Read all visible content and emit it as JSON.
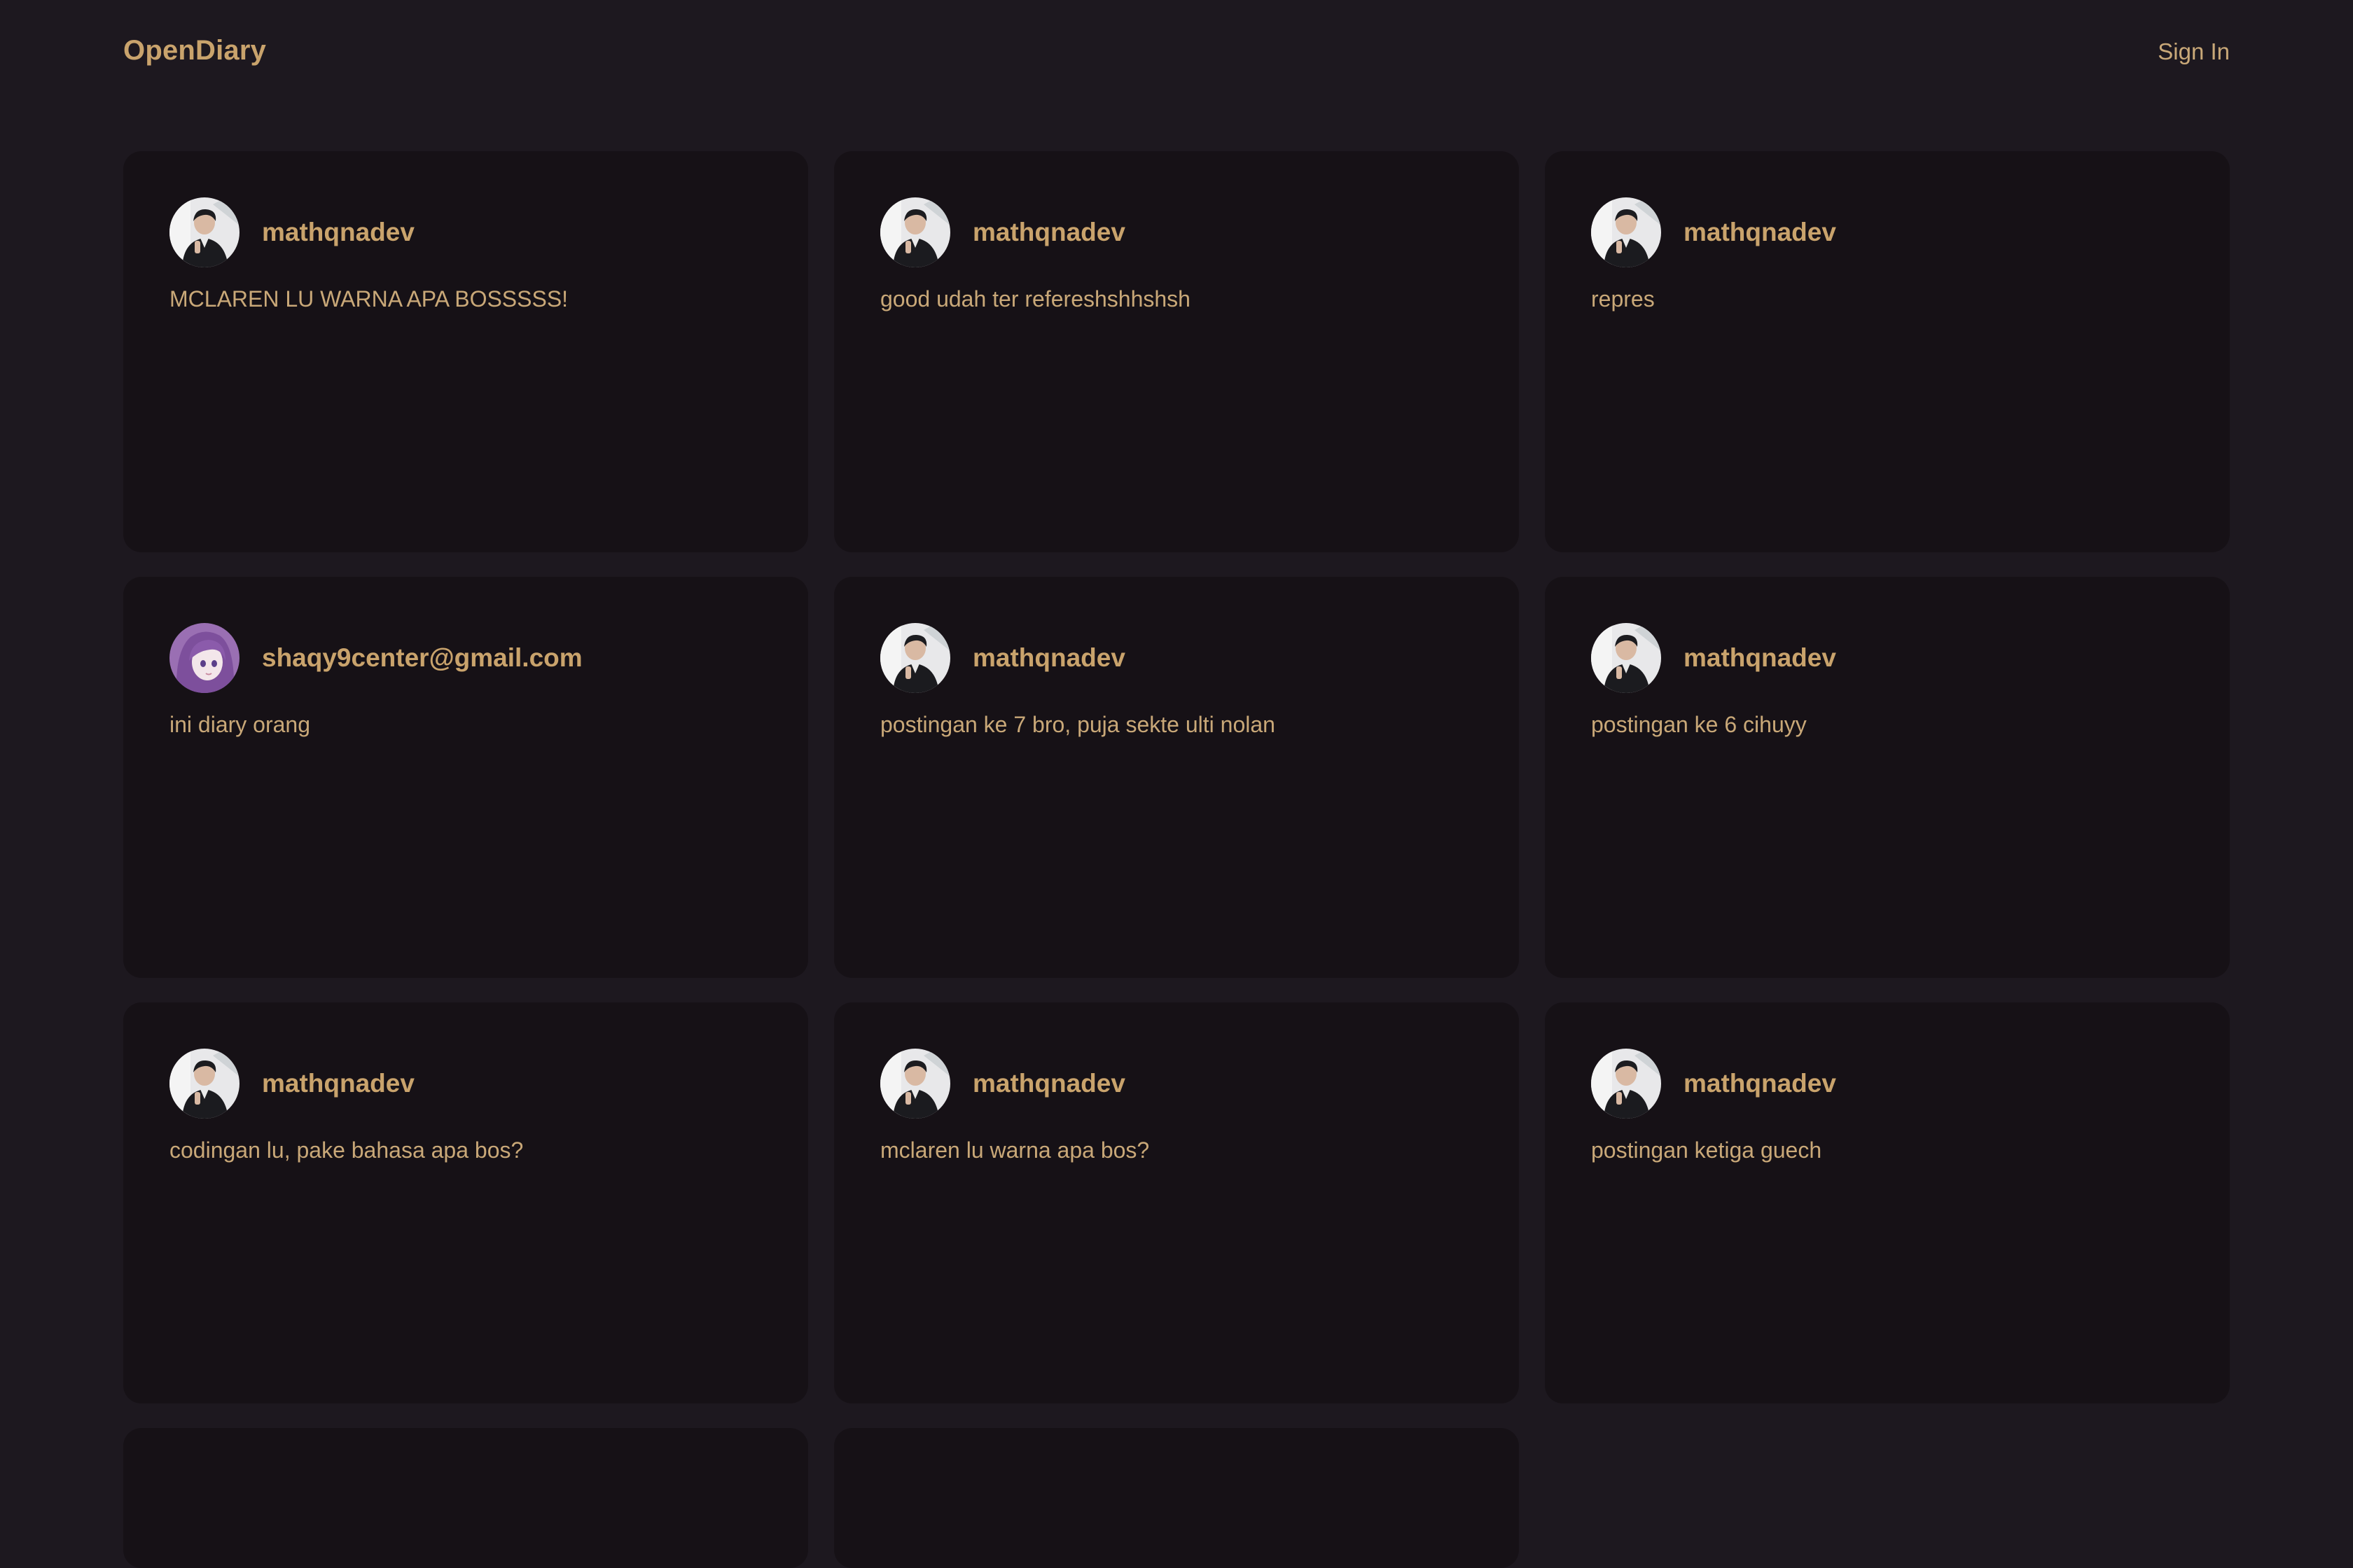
{
  "header": {
    "brand": "OpenDiary",
    "signin_label": "Sign In"
  },
  "posts": [
    {
      "username": "mathqnadev",
      "content": "MCLAREN LU WARNA APA BOSSSSS!",
      "avatar": "man-in-suit-avatar"
    },
    {
      "username": "mathqnadev",
      "content": "good udah ter refereshshhshsh",
      "avatar": "man-in-suit-avatar"
    },
    {
      "username": "mathqnadev",
      "content": "repres",
      "avatar": "man-in-suit-avatar"
    },
    {
      "username": "shaqy9center@gmail.com",
      "content": "ini diary orang",
      "avatar": "purple-hair-anime-avatar"
    },
    {
      "username": "mathqnadev",
      "content": "postingan ke 7 bro, puja sekte ulti nolan",
      "avatar": "man-in-suit-avatar"
    },
    {
      "username": "mathqnadev",
      "content": "postingan ke 6 cihuyy",
      "avatar": "man-in-suit-avatar"
    },
    {
      "username": "mathqnadev",
      "content": "codingan lu, pake bahasa apa bos?",
      "avatar": "man-in-suit-avatar"
    },
    {
      "username": "mathqnadev",
      "content": "mclaren lu warna apa bos?",
      "avatar": "man-in-suit-avatar"
    },
    {
      "username": "mathqnadev",
      "content": "postingan ketiga guech",
      "avatar": "man-in-suit-avatar"
    }
  ],
  "colors": {
    "background": "#1d181f",
    "card": "#161116",
    "accent": "#c9a36c"
  }
}
